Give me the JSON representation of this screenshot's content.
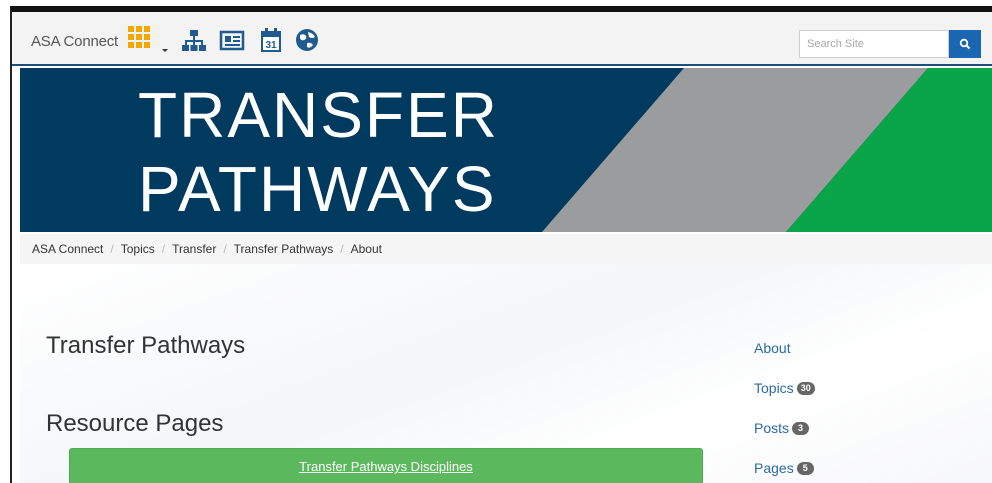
{
  "navbar": {
    "brand": "ASA Connect",
    "icons": [
      "apps-grid-icon",
      "sitemap-icon",
      "newspaper-icon",
      "calendar-icon",
      "globe-icon"
    ],
    "calendar_day": "31",
    "search": {
      "placeholder": "Search Site"
    }
  },
  "banner": {
    "line1": "TRANSFER",
    "line2": "PATHWAYS"
  },
  "breadcrumb": [
    "ASA Connect",
    "Topics",
    "Transfer",
    "Transfer Pathways",
    "About"
  ],
  "main": {
    "page_title": "Transfer Pathways",
    "section_title": "Resource Pages",
    "resource_button": "Transfer Pathways Disciplines"
  },
  "side_nav": [
    {
      "label": "About",
      "badge": ""
    },
    {
      "label": "Topics",
      "badge": "30"
    },
    {
      "label": "Posts",
      "badge": "3"
    },
    {
      "label": "Pages",
      "badge": "5"
    }
  ],
  "colors": {
    "navbar_bg": "#f3f3f3",
    "banner_blue": "#003b5f",
    "banner_gray": "#9a9c9e",
    "banner_green": "#0aa548",
    "search_button": "#1a66b0",
    "link_blue": "#2b6aa5",
    "button_green": "#5cb85c",
    "icon_orange": "#f0a800",
    "icon_blue": "#1f5b8f"
  }
}
